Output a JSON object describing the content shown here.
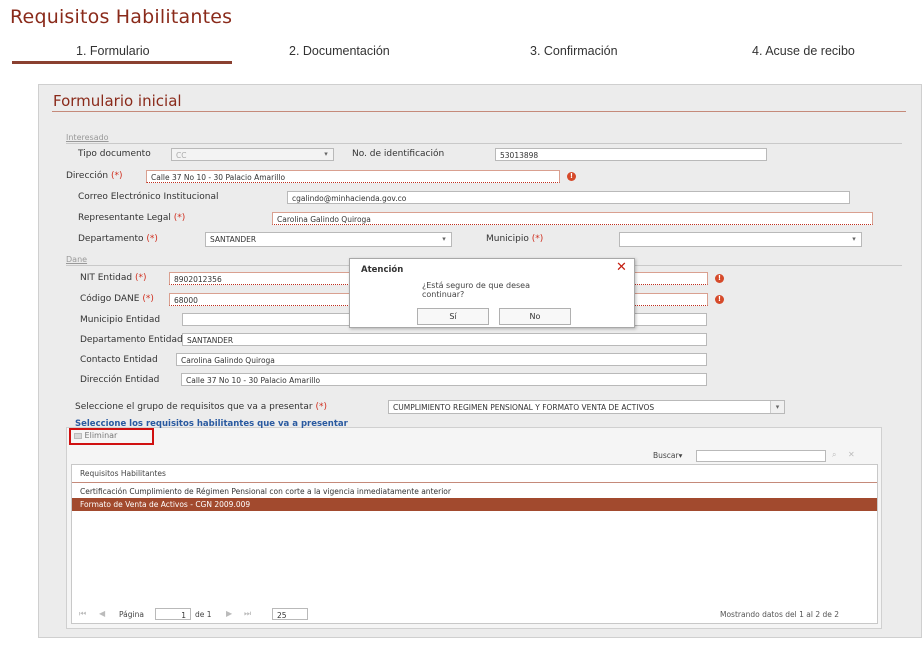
{
  "page": {
    "title": "Requisitos Habilitantes",
    "steps": [
      "1. Formulario",
      "2. Documentación",
      "3. Confirmación",
      "4. Acuse de recibo"
    ]
  },
  "form": {
    "title": "Formulario inicial",
    "interesado": {
      "legend": "Interesado",
      "tipo_documento_label": "Tipo documento",
      "tipo_documento_value": "CC",
      "no_identificacion_label": "No. de identificación",
      "no_identificacion_value": "53013898",
      "direccion_label": "Dirección",
      "direccion_value": "Calle 37 No 10 - 30 Palacio Amarillo",
      "correo_label": "Correo Electrónico Institucional",
      "correo_value": "cgalindo@minhacienda.gov.co",
      "representante_label": "Representante Legal",
      "representante_value": "Carolina Galindo Quiroga",
      "departamento_label": "Departamento",
      "departamento_value": "SANTANDER",
      "municipio_label": "Municipio",
      "municipio_value": ""
    },
    "dane": {
      "legend": "Dane",
      "nit_label": "NIT Entidad",
      "nit_value": "8902012356",
      "codigo_label": "Código DANE",
      "codigo_value": "68000",
      "municipio_entidad_label": "Municipio Entidad",
      "municipio_entidad_value": "",
      "departamento_entidad_label": "Departamento Entidad",
      "departamento_entidad_value": "SANTANDER",
      "contacto_label": "Contacto Entidad",
      "contacto_value": "Carolina Galindo Quiroga",
      "direccion_entidad_label": "Dirección Entidad",
      "direccion_entidad_value": "Calle 37 No 10 - 30 Palacio Amarillo"
    },
    "req_marker": "(*)",
    "grupo_label": "Seleccione el grupo de requisitos que va a presentar",
    "grupo_value": "CUMPLIMIENTO REGIMEN PENSIONAL Y FORMATO VENTA DE ACTIVOS",
    "select_link": "Seleccione los requisitos habilitantes que va a presentar"
  },
  "grid": {
    "delete_label": "Eliminar",
    "search_label": "Buscar",
    "search_value": "",
    "column_header": "Requisitos Habilitantes",
    "rows": [
      "Certificación Cumplimiento de Régimen Pensional con corte a la vigencia inmediatamente anterior",
      "Formato de Venta de Activos - CGN 2009.009"
    ],
    "selected_row": 1,
    "pager": {
      "page_label": "Página",
      "page_value": "1",
      "of_label": "de 1",
      "page_size": "25",
      "status": "Mostrando datos del 1 al 2 de 2"
    }
  },
  "dialog": {
    "title": "Atención",
    "message_line1": "¿Está seguro de que desea",
    "message_line2": "continuar?",
    "yes_label": "Sí",
    "no_label": "No"
  },
  "colors": {
    "brand": "#8a2a1a",
    "selected_row": "#a24a2e",
    "required": "#d03020",
    "error_icon": "#d64a2a"
  }
}
